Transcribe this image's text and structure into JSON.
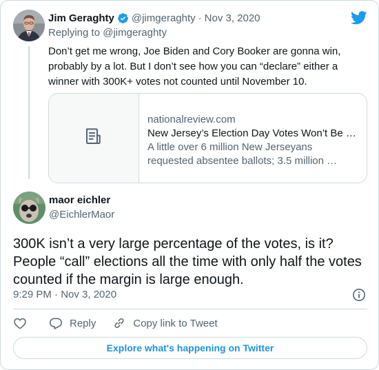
{
  "colors": {
    "twitter_blue": "#1d9bf0",
    "link_blue": "#1b95e0",
    "text_primary": "#0f1419",
    "text_secondary": "#536471",
    "border": "#cfd9de"
  },
  "parent_tweet": {
    "author_name": "Jim Geraghty",
    "handle": "@jimgeraghty",
    "separator": "·",
    "date": "Nov 3, 2020",
    "verified_icon": "verified-badge-icon",
    "replying_to": "Replying to @jimgeraghty",
    "text": "Don’t get me wrong, Joe Biden and Cory Booker are gonna win, probably by a lot. But I don’t see how you can “declare” either a winner with 300K+ votes not counted until November 10.",
    "link_card": {
      "thumbnail_icon": "article-icon",
      "domain": "nationalreview.com",
      "title": "New Jersey’s Election Day Votes Won’t Be …",
      "description": "A little over 6 million New Jerseyans requested absentee ballots; 3.5 million …"
    }
  },
  "main_tweet": {
    "author_name": "maor eichler",
    "handle": "@EichlerMaor",
    "text": "300K isn’t a very large percentage of the votes, is it? People “call” elections all the time with only half the votes counted if the margin is large enough.",
    "timestamp": "9:29 PM · Nov 3, 2020"
  },
  "actions": {
    "like_icon": "heart-icon",
    "reply_icon": "reply-icon",
    "reply_label": "Reply",
    "copy_icon": "link-icon",
    "copy_label": "Copy link to Tweet"
  },
  "explore_label": "Explore what's happening on Twitter"
}
